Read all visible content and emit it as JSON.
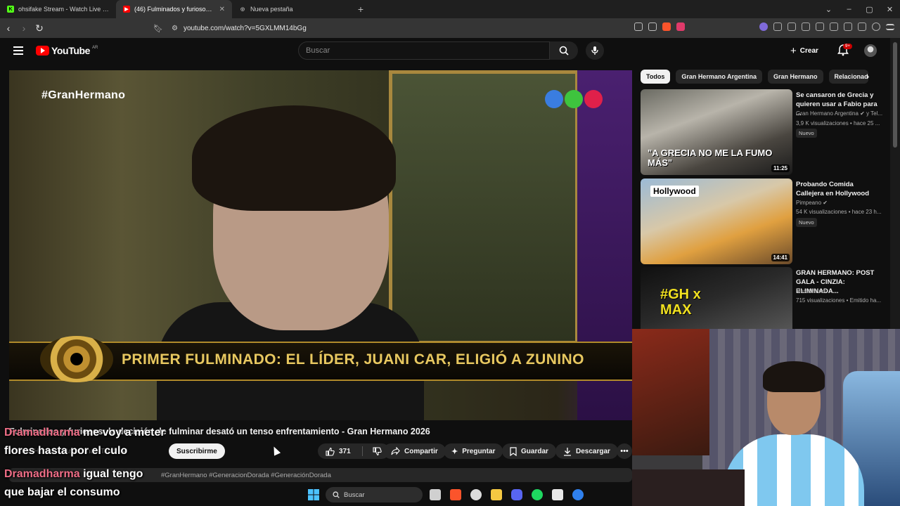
{
  "browser": {
    "tabs": [
      {
        "title": "ohsifake Stream - Watch Live on Kick",
        "favicon_color": "#53fc18",
        "favicon_letter": "K"
      },
      {
        "title": "(46) Fulminados y furiosos: la de",
        "favicon_color": "#ff0000",
        "favicon_letter": "▶"
      },
      {
        "title": "Nueva pestaña",
        "favicon_color": "#888888",
        "favicon_letter": "◎"
      }
    ],
    "url": "youtube.com/watch?v=5GXLMM14bGg"
  },
  "youtube": {
    "logo_text": "YouTube",
    "country_code": "AR",
    "search_placeholder": "Buscar",
    "create_label": "Crear",
    "notifications_badge": "9+"
  },
  "player": {
    "hashtag_overlay": "#GranHermano",
    "lower_third": "PRIMER FULMINADO: EL LÍDER, JUANI CAR, ELIGIÓ A ZUNINO",
    "channel_dots_colors": [
      "#3a7de0",
      "#3ec43e",
      "#e0204a"
    ]
  },
  "video": {
    "title": "Fulminados y furiosos: la decisión de fulminar desató un tenso enfrentamiento - Gran Hermano 2026",
    "channel_name": "Gran Hermano Argentina · Telefe",
    "subscribe_label": "Suscribirme",
    "likes": "371",
    "share_label": "Compartir",
    "ask_label": "Preguntar",
    "save_label": "Guardar",
    "download_label": "Descargar",
    "description_tags": "#GranHermano #GeneracionDorada #GeneraciónDorada"
  },
  "chat": [
    {
      "user": "Dramadharma",
      "message": "me voy a meter"
    },
    {
      "user": "",
      "message": "flores hasta por el culo"
    },
    {
      "user": "Dramadharma",
      "message": "igual tengo"
    },
    {
      "user": "",
      "message": "que bajar el consumo"
    }
  ],
  "chips": [
    "Todos",
    "Gran Hermano Argentina",
    "Gran Hermano",
    "Relacionad"
  ],
  "recommendations": [
    {
      "title": "Se cansaron de Grecia y quieren usar a Fabio para ...",
      "channel": "Gran Hermano Argentina ✔ y Tel...",
      "meta": "3,9 K visualizaciones • hace 25 ...",
      "badge": "Nuevo",
      "duration": "11:25",
      "thumb_text": "\"A GRECIA NO ME LA FUMO MÁS\""
    },
    {
      "title": "Probando Comida Callejera en Hollywood",
      "channel": "Pimpeano ✔",
      "meta": "54 K visualizaciones • hace 23 h...",
      "badge": "Nuevo",
      "duration": "14:41",
      "thumb_text": "Hollywood"
    },
    {
      "title": "GRAN HERMANO: POST GALA - CINZIA: ELIMINADA...",
      "channel": "Max Orlandi",
      "meta": "715 visualizaciones • Emitido ha...",
      "badge": "",
      "duration": "",
      "thumb_text": "#GH x MAX"
    }
  ],
  "taskbar": {
    "search_label": "Buscar"
  }
}
